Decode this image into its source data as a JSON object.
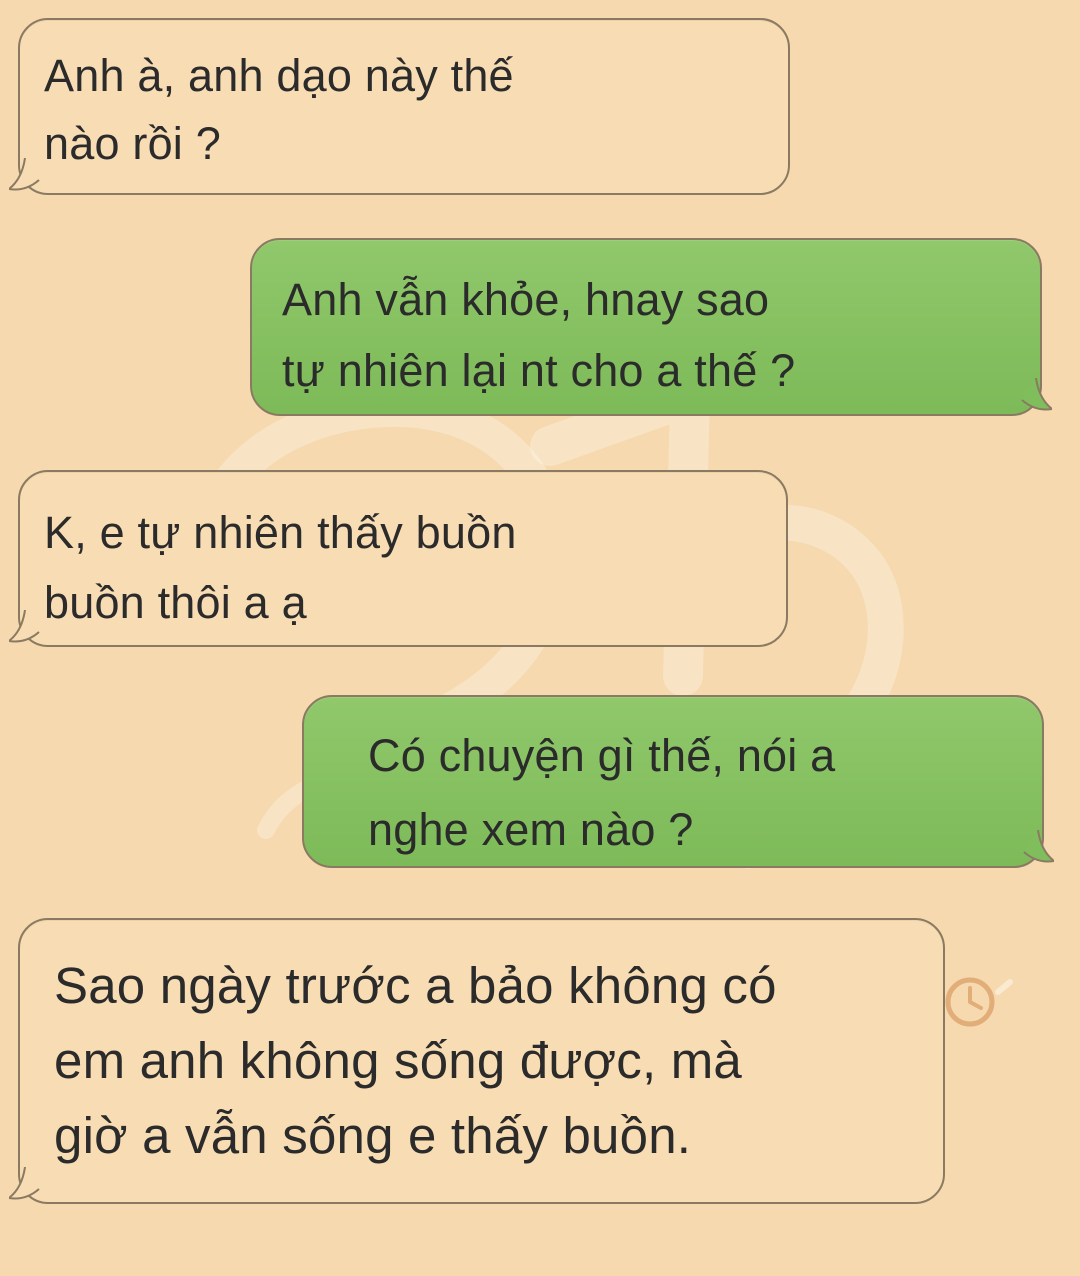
{
  "chat": {
    "messages": [
      {
        "sender": "other",
        "text": "Anh à, anh dạo này thế\nnào rồi ?"
      },
      {
        "sender": "self",
        "text": "Anh vẫn khỏe, hnay sao\ntự nhiên lại nt cho a thế ?"
      },
      {
        "sender": "other",
        "text": "K, e tự nhiên thấy buồn\nbuồn thôi a ạ"
      },
      {
        "sender": "self",
        "text": "Có chuyện gì thế, nói a\nnghe xem nào ?"
      },
      {
        "sender": "other",
        "text": "Sao ngày trước a bảo không có\nem anh không sống được, mà\ngiờ a vẫn sống e thấy buồn."
      }
    ]
  },
  "theme": {
    "background": "#f6d9ae",
    "incoming_bubble": "#f8dcb3",
    "outgoing_bubble": "#7fbd5c",
    "border": "#8a7a62",
    "text": "#2b2b2b",
    "watermark": "#ffffff"
  },
  "decor": {
    "watermark_icon": "watermark-logo-icon",
    "clock_icon": "clock-icon"
  }
}
